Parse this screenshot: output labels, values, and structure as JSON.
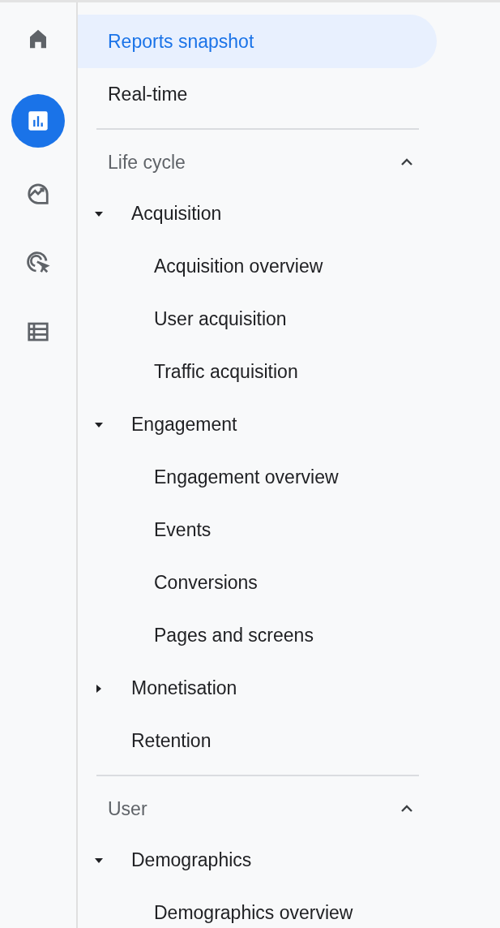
{
  "rail": [
    {
      "kind": "home",
      "selected": false
    },
    {
      "kind": "reports",
      "selected": true
    },
    {
      "kind": "explore",
      "selected": false
    },
    {
      "kind": "advertising",
      "selected": false
    },
    {
      "kind": "configure",
      "selected": false
    }
  ],
  "top_items": [
    {
      "label": "Reports snapshot",
      "selected": true
    },
    {
      "label": "Real-time",
      "selected": false
    }
  ],
  "sections": [
    {
      "label": "Life cycle",
      "expanded": true,
      "items": [
        {
          "kind": "group",
          "label": "Acquisition",
          "expanded": true,
          "children": [
            {
              "label": "Acquisition overview"
            },
            {
              "label": "User acquisition"
            },
            {
              "label": "Traffic acquisition"
            }
          ]
        },
        {
          "kind": "group",
          "label": "Engagement",
          "expanded": true,
          "children": [
            {
              "label": "Engagement overview"
            },
            {
              "label": "Events"
            },
            {
              "label": "Conversions"
            },
            {
              "label": "Pages and screens"
            }
          ]
        },
        {
          "kind": "group",
          "label": "Monetisation",
          "expanded": false
        },
        {
          "kind": "leaf",
          "label": "Retention"
        }
      ]
    },
    {
      "label": "User",
      "expanded": true,
      "items": [
        {
          "kind": "group",
          "label": "Demographics",
          "expanded": true,
          "children": [
            {
              "label": "Demographics overview"
            }
          ]
        }
      ]
    }
  ]
}
